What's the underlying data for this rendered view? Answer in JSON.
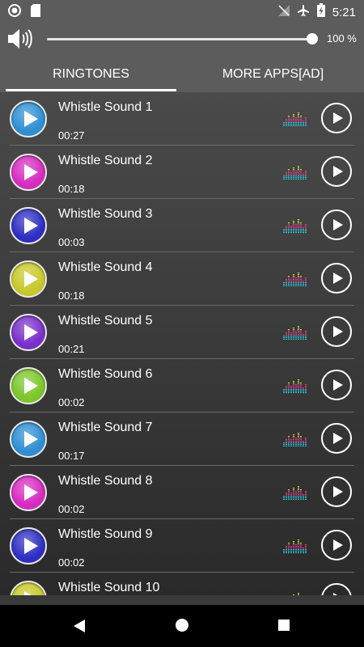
{
  "status_bar": {
    "time": "5:21"
  },
  "volume": {
    "percent_label": "100 %",
    "level": 1.0
  },
  "tabs": [
    {
      "label": "RINGTONES",
      "selected": true
    },
    {
      "label": "MORE APPS[AD]",
      "selected": false
    }
  ],
  "ringtones": [
    {
      "title": "Whistle Sound 1",
      "duration": "00:27",
      "color": "#2f8fd3"
    },
    {
      "title": "Whistle Sound 2",
      "duration": "00:18",
      "color": "#d62bc0"
    },
    {
      "title": "Whistle Sound 3",
      "duration": "00:03",
      "color": "#2e2ec2"
    },
    {
      "title": "Whistle Sound 4",
      "duration": "00:18",
      "color": "#c8c82a"
    },
    {
      "title": "Whistle Sound 5",
      "duration": "00:21",
      "color": "#7a2fc9"
    },
    {
      "title": "Whistle Sound 6",
      "duration": "00:02",
      "color": "#7cc62a"
    },
    {
      "title": "Whistle Sound 7",
      "duration": "00:17",
      "color": "#2f8fd3"
    },
    {
      "title": "Whistle Sound 8",
      "duration": "00:02",
      "color": "#d62bc0"
    },
    {
      "title": "Whistle Sound 9",
      "duration": "00:02",
      "color": "#2e2ec2"
    },
    {
      "title": "Whistle Sound 10",
      "duration": "",
      "color": "#c8c82a"
    }
  ]
}
